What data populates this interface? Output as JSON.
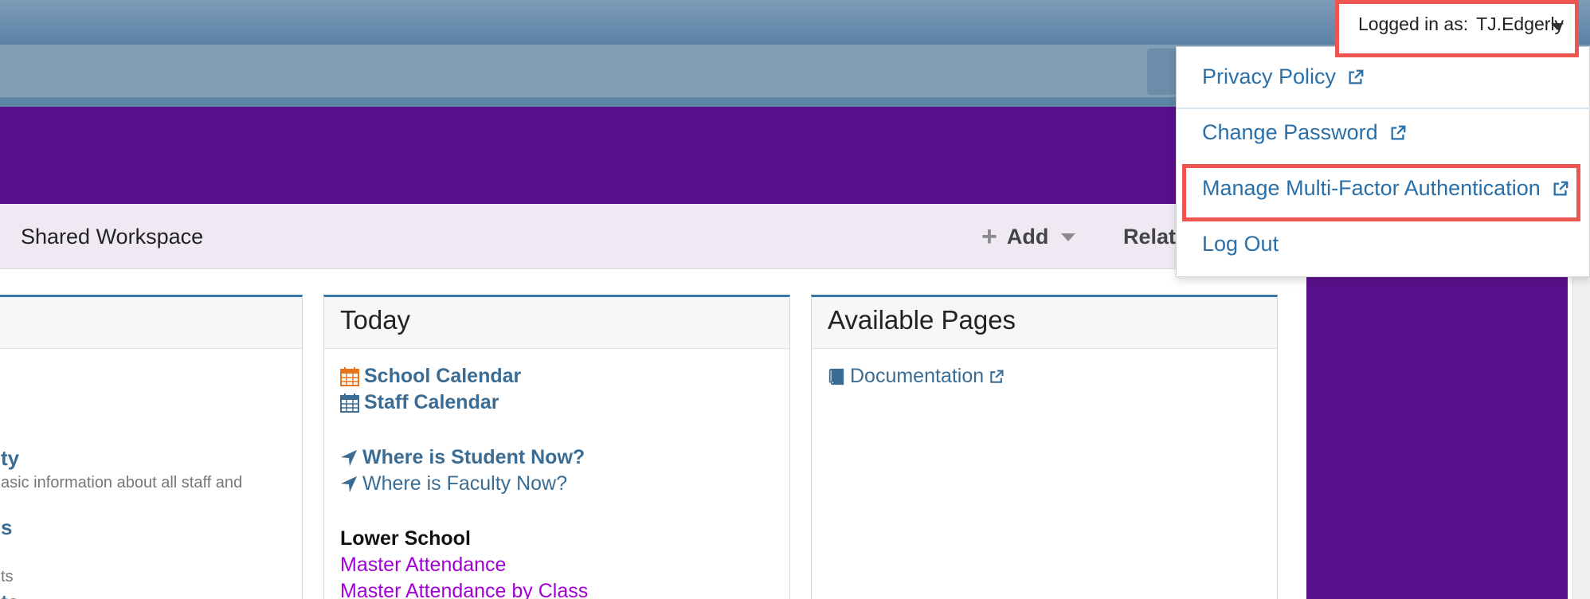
{
  "header": {
    "logged_in_label": "Logged in as:",
    "username": "TJ.Edgerly"
  },
  "user_menu": {
    "items": [
      {
        "label": "Privacy Policy"
      },
      {
        "label": "Change Password"
      },
      {
        "label": "Manage Multi-Factor Authentication"
      },
      {
        "label": "Log Out"
      }
    ]
  },
  "nav": {
    "shared_workspace": "Shared Workspace",
    "add": "Add",
    "related": "Relate"
  },
  "left_card": {
    "link1": "ty",
    "desc1": "asic information about all staff and",
    "link2": "s",
    "desc2": "ts",
    "link3": "ts"
  },
  "today": {
    "title": "Today",
    "school_calendar": "School Calendar",
    "staff_calendar": "Staff Calendar",
    "where_student": "Where is Student Now?",
    "where_faculty": "Where is Faculty Now?",
    "lower_school": "Lower School",
    "master_attendance": "Master Attendance",
    "master_attendance_class": "Master Attendance by Class"
  },
  "available_pages": {
    "title": "Available Pages",
    "documentation": "Documentation"
  },
  "colors": {
    "banner": "#5a0f8c",
    "link": "#3a6c94",
    "highlight": "#ef5550"
  }
}
